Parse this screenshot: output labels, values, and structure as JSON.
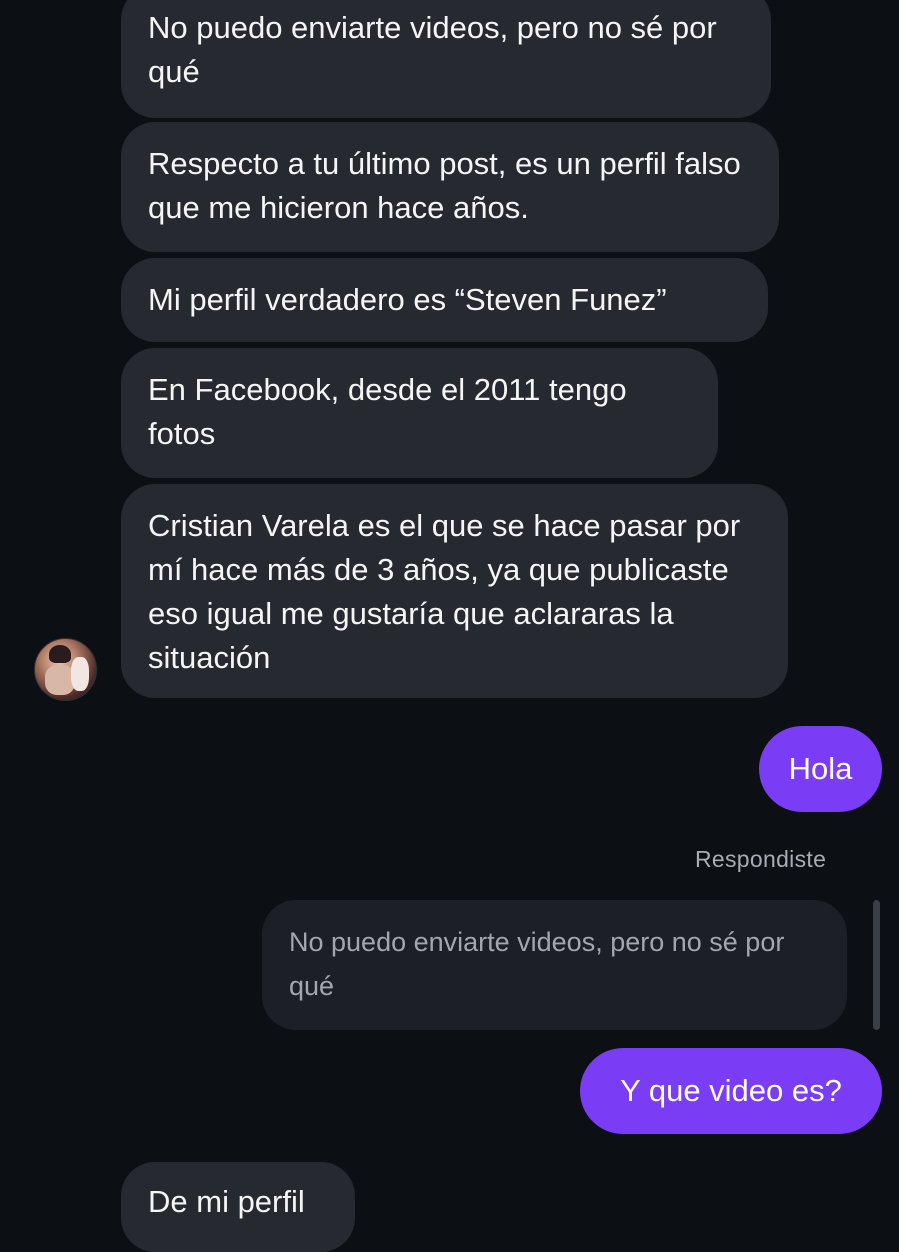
{
  "incoming": [
    "No puedo enviarte videos, pero no sé por qué",
    "Respecto a tu último post, es un perfil falso que me hicieron hace años.",
    "Mi perfil verdadero es “Steven Funez”",
    "En Facebook, desde el 2011 tengo fotos",
    "Cristian Varela es el que se hace pasar por mí hace más de 3 años, ya que publicaste eso igual me gustaría que aclararas la situación"
  ],
  "outgoing": [
    "Hola",
    "Y que video es?"
  ],
  "reply": {
    "label": "Respondiste",
    "quoted": "No puedo enviarte videos, pero no sé por qué"
  },
  "partial_last_message": "De mi perfil",
  "colors": {
    "background": "#0c1014",
    "incoming_bubble": "#262a30",
    "outgoing_bubble": "#7b3cf5"
  }
}
